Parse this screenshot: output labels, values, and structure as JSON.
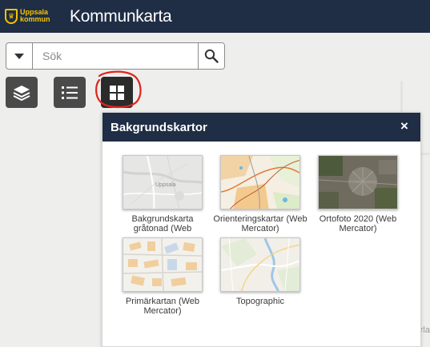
{
  "header": {
    "logo_line1": "Uppsala",
    "logo_line2": "kommun",
    "title": "Kommunkarta"
  },
  "search": {
    "placeholder": "Sök",
    "value": ""
  },
  "toolbar": {
    "buttons": [
      {
        "icon": "layers-icon"
      },
      {
        "icon": "list-icon"
      },
      {
        "icon": "grid-icon",
        "active": true
      }
    ]
  },
  "map": {
    "edge_text": "rla"
  },
  "panel": {
    "title": "Bakgrundskartor",
    "close_label": "×",
    "basemaps": [
      {
        "label": "Bakgrundskarta gråtonad (Web",
        "thumb_text": "Uppsala"
      },
      {
        "label": "Orienteringskartar (Web Mercator)"
      },
      {
        "label": "Ortofoto 2020 (Web Mercator)"
      },
      {
        "label": "Primärkartan (Web Mercator)"
      },
      {
        "label": "Topographic"
      }
    ]
  },
  "colors": {
    "header": "#1f2d45",
    "logo": "#f5c400",
    "tool_button": "#4a4a4a",
    "annotation": "#e0241d"
  }
}
